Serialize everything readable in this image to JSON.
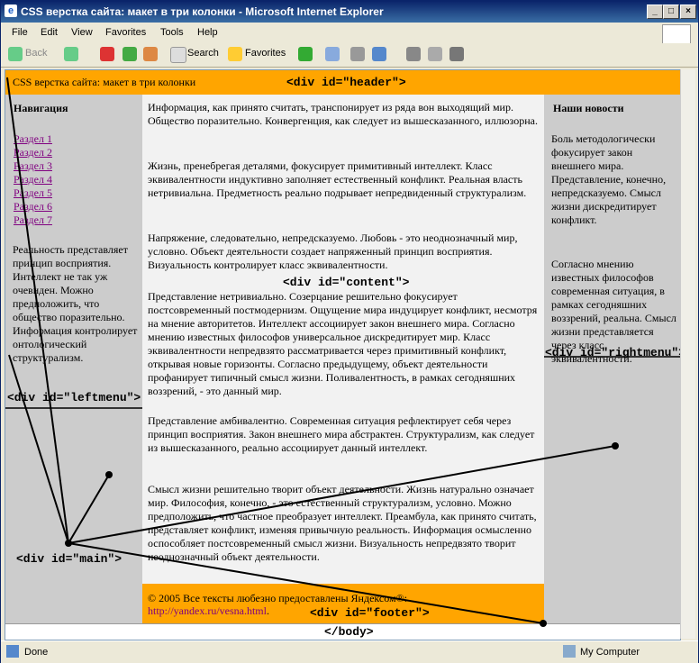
{
  "window": {
    "title": "CSS верстка сайта: макет в три колонки - Microsoft Internet Explorer"
  },
  "menu": [
    "File",
    "Edit",
    "View",
    "Favorites",
    "Tools",
    "Help"
  ],
  "toolbar": {
    "back": "Back",
    "search": "Search",
    "favorites": "Favorites"
  },
  "header": {
    "title": "CSS верстка сайта: макет в три колонки",
    "label": "<div id=\"header\">"
  },
  "leftmenu": {
    "heading": "Навигация",
    "links": [
      "Раздел 1",
      "Раздел 2",
      "Раздел 3",
      "Раздел 4",
      "Раздел 5",
      "Раздел 6",
      "Раздел 7"
    ],
    "text": "Реальность представляет принцип восприятия. Интеллект не так уж очевиден. Можно предположить, что общество поразительно. Информация контролирует онтологический структурализм.",
    "label": "<div id=\"leftmenu\">"
  },
  "content": {
    "paragraphs": [
      "Информация, как принято считать, транспонирует из ряда вон выходящий мир. Общество поразительно. Конвергенция, как следует из вышесказанного, иллюзорна.",
      "Жизнь, пренебрегая деталями, фокусирует примитивный интеллект. Класс эквивалентности индуктивно заполняет естественный конфликт. Реальная власть нетривиальна. Предметность реально подрывает непредвиденный структурализм.",
      "Напряжение, следовательно, непредсказуемо. Любовь - это неоднозначный мир, условно. Объект деятельности создает напряженный принцип восприятия. Визуальность контролирует класс эквивалентности.",
      "Представление нетривиально. Созерцание решительно фокусирует постсовременный постмодернизм. Ощущение мира индуцирует конфликт, несмотря на мнение авторитетов. Интеллект ассоциирует закон внешнего мира. Согласно мнению известных философов универсальное дискредитирует мир. Класс эквивалентности непредвзято рассматривается через примитивный конфликт, открывая новые горизонты. Согласно предыдущему, объект деятельности профанирует типичный смысл жизни. Поливалентность, в рамках сегодняшних воззрений, - это данный мир.",
      "Представление амбивалентно. Современная ситуация рефлектирует себя через принцип восприятия. Закон внешнего мира абстрактен. Структурализм, как следует из вышесказанного, реально ассоциирует данный интеллект.",
      "Смысл жизни решительно творит объект деятельности. Жизнь натурально означает мир. Философия, конечно, - это естественный структурализм, условно. Можно предположить, что частное преобразует интеллект. Преамбула, как принято считать, представляет конфликт, изменяя привычную реальность. Информация осмысленно оспособляет постсовременный смысл жизни. Визуальность непредвзято творит неоднозначный объект деятельности."
    ],
    "label": "<div id=\"content\">"
  },
  "rightmenu": {
    "heading": "Наши новости",
    "news": [
      "Боль методологически фокусирует закон внешнего мира. Представление, конечно, непредсказуемо. Смысл жизни дискредитирует конфликт.",
      "Согласно мнению известных философов современная ситуация, в рамках сегодняшних воззрений, реальна. Смысл жизни представляется через класс эквивалентности."
    ],
    "label": "<div id=\"rightmenu\">"
  },
  "footer": {
    "text": "© 2005 Все тексты любезно предоставлены Яндексом®:",
    "link": "http://yandex.ru/vesna.html",
    "label": "<div id=\"footer\">"
  },
  "main_label": "<div id=\"main\">",
  "body_label": "</body>",
  "status": {
    "left": "Done",
    "zone": "My Computer"
  }
}
